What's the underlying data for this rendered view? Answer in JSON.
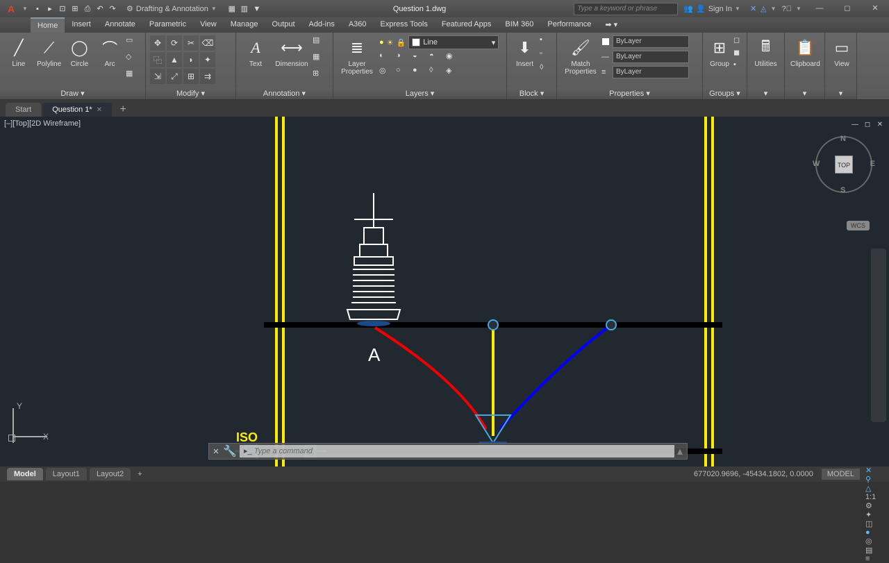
{
  "title": "Question 1.dwg",
  "workspace": "Drafting & Annotation",
  "search_placeholder": "Type a keyword or phrase",
  "sign_in": "Sign In",
  "menu": [
    "Home",
    "Insert",
    "Annotate",
    "Parametric",
    "View",
    "Manage",
    "Output",
    "Add-ins",
    "A360",
    "Express Tools",
    "Featured Apps",
    "BIM 360",
    "Performance"
  ],
  "panels": {
    "draw": {
      "title": "Draw ▾",
      "tools": [
        "Line",
        "Polyline",
        "Circle",
        "Arc"
      ]
    },
    "modify": {
      "title": "Modify ▾"
    },
    "annotation": {
      "title": "Annotation ▾",
      "tools": [
        "Text",
        "Dimension"
      ]
    },
    "layers": {
      "title": "Layers ▾",
      "prop": "Layer Properties",
      "current": "Line"
    },
    "block": {
      "title": "Block ▾",
      "tool": "Insert"
    },
    "properties": {
      "title": "Properties ▾",
      "match": "Match Properties",
      "bylayer": "ByLayer"
    },
    "groups": {
      "title": "Groups ▾",
      "tool": "Group"
    },
    "utilities": {
      "title": "Utilities"
    },
    "clipboard": {
      "title": "Clipboard"
    },
    "view": {
      "title": "View"
    }
  },
  "filetabs": {
    "start": "Start",
    "current": "Question 1*"
  },
  "viewport_label": "[–][Top][2D Wireframe]",
  "viewcube": {
    "center": "TOP",
    "n": "N",
    "s": "S",
    "e": "E",
    "w": "W"
  },
  "wcs": "WCS",
  "ucs": {
    "y": "Y",
    "x": "X"
  },
  "annotation_a": "A",
  "iso": "ISO",
  "cmd_placeholder": "Type a command",
  "layouts": [
    "Model",
    "Layout1",
    "Layout2"
  ],
  "status": {
    "coords": "677020.9696, -45434.1802, 0.0000",
    "model": "MODEL",
    "scale": "1:1"
  }
}
